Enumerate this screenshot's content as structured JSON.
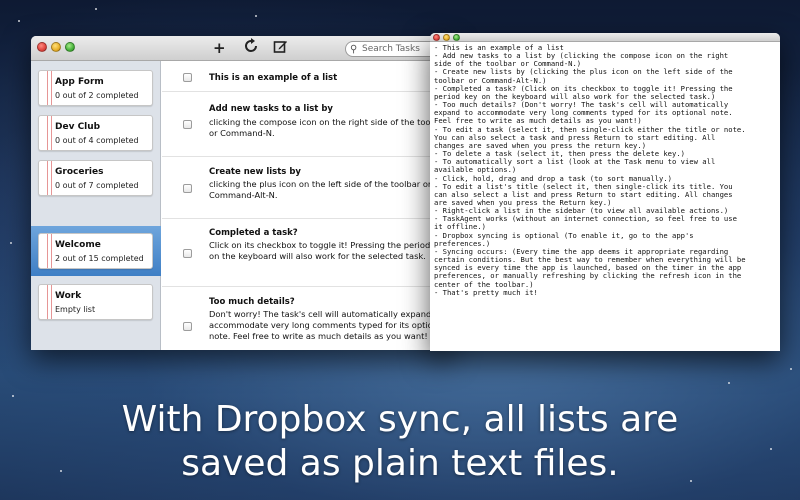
{
  "toolbar": {
    "add_icon": "plus-icon",
    "refresh_icon": "refresh-icon",
    "compose_icon": "compose-icon",
    "search_placeholder": "Search Tasks"
  },
  "sidebar": {
    "lists": [
      {
        "name": "App Form",
        "count": "0 out of 2 completed"
      },
      {
        "name": "Dev Club",
        "count": "0 out of 4 completed"
      },
      {
        "name": "Groceries",
        "count": "0 out of 7 completed"
      },
      {
        "name": "Welcome",
        "count": "2 out of 15 completed",
        "selected": true
      },
      {
        "name": "Work",
        "count": "Empty list"
      }
    ]
  },
  "tasks": [
    {
      "title": "This is an example of a list",
      "note": ""
    },
    {
      "title": "Add new tasks to a list by",
      "note": "clicking the compose icon on the right side of the toolbar\nor Command-N."
    },
    {
      "title": "Create new lists by",
      "note": "clicking the plus icon on the left side of the toolbar or\nCommand-Alt-N."
    },
    {
      "title": "Completed a task?",
      "note": "Click on its checkbox to toggle it! Pressing the period key\non the keyboard will also work for the selected task."
    },
    {
      "title": "Too much details?",
      "note": "Don't worry! The task's cell will automatically expand to\naccommodate very long comments typed for its optional\nnote. Feel free to write as much details as you want!"
    }
  ],
  "text_file": {
    "lines": [
      "- This is an example of a list",
      "- Add new tasks to a list by (clicking the compose icon on the right",
      "side of the toolbar or Command-N.)",
      "- Create new lists by (clicking the plus icon on the left side of the",
      "toolbar or Command-Alt-N.)",
      "- Completed a task? (Click on its checkbox to toggle it! Pressing the",
      "period key on the keyboard will also work for the selected task.)",
      "- Too much details? (Don't worry! The task's cell will automatically",
      "expand to accommodate very long comments typed for its optional note.",
      "Feel free to write as much details as you want!)",
      "- To edit a task (select it, then single-click either the title or note.",
      "You can also select a task and press Return to start editing. All",
      "changes are saved when you press the return key.)",
      "- To delete a task (select it, then press the delete key.)",
      "- To automatically sort a list (look at the Task menu to view all",
      "available options.)",
      "- Click, hold, drag and drop a task (to sort manually.)",
      "- To edit a list's title (select it, then single-click its title. You",
      "can also select a list and press Return to start editing. All changes",
      "are saved when you press the Return key.)",
      "- Right-click a list in the sidebar (to view all available actions.)",
      "- TaskAgent works (without an internet connection, so feel free to use",
      "it offline.)",
      "- Dropbox syncing is optional (To enable it, go to the app's",
      "preferences.)",
      "- Syncing occurs: (Every time the app deems it appropriate regarding",
      "certain conditions. But the best way to remember when everything will be",
      "synced is every time the app is launched, based on the timer in the app",
      "preferences, or manually refreshing by clicking the refresh icon in the",
      "center of the toolbar.)",
      "- That's pretty much it!"
    ]
  },
  "caption": {
    "line1": "With Dropbox sync, all lists are",
    "line2": "saved as plain text files."
  }
}
